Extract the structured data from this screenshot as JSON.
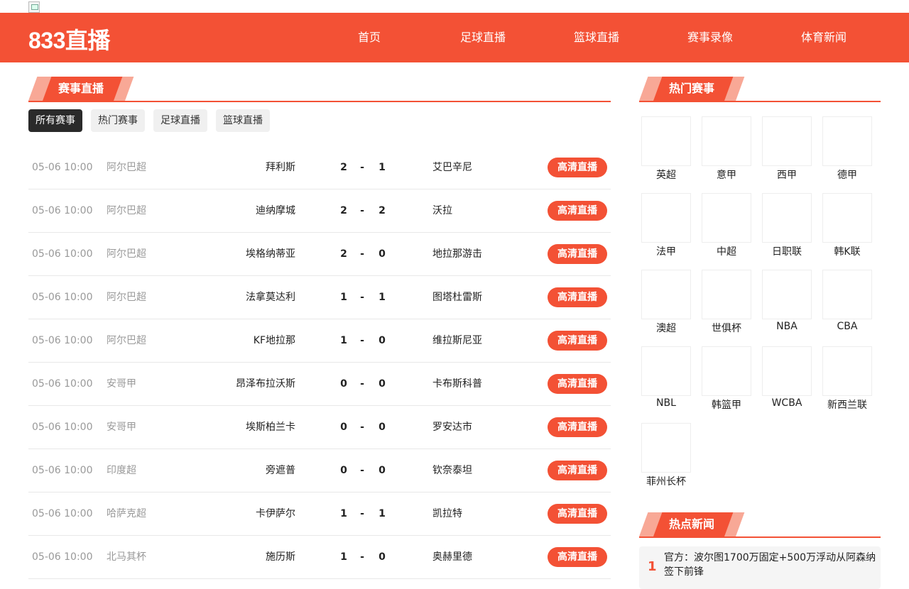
{
  "site": {
    "logo": "833直播"
  },
  "nav": [
    "首页",
    "足球直播",
    "篮球直播",
    "赛事录像",
    "体育新闻"
  ],
  "live_section": {
    "title": "赛事直播",
    "filters": [
      "所有赛事",
      "热门赛事",
      "足球直播",
      "篮球直播"
    ],
    "active_filter": 0,
    "button_label": "高清直播",
    "matches": [
      {
        "time": "05-06 10:00",
        "league": "阿尔巴超",
        "home": "拜利斯",
        "home_score": "2",
        "away_score": "1",
        "away": "艾巴辛尼"
      },
      {
        "time": "05-06 10:00",
        "league": "阿尔巴超",
        "home": "迪纳摩城",
        "home_score": "2",
        "away_score": "2",
        "away": "沃拉"
      },
      {
        "time": "05-06 10:00",
        "league": "阿尔巴超",
        "home": "埃格纳蒂亚",
        "home_score": "2",
        "away_score": "0",
        "away": "地拉那游击"
      },
      {
        "time": "05-06 10:00",
        "league": "阿尔巴超",
        "home": "法拿莫达利",
        "home_score": "1",
        "away_score": "1",
        "away": "图塔杜雷斯"
      },
      {
        "time": "05-06 10:00",
        "league": "阿尔巴超",
        "home": "KF地拉那",
        "home_score": "1",
        "away_score": "0",
        "away": "维拉斯尼亚"
      },
      {
        "time": "05-06 10:00",
        "league": "安哥甲",
        "home": "昂泽布拉沃斯",
        "home_score": "0",
        "away_score": "0",
        "away": "卡布斯科普"
      },
      {
        "time": "05-06 10:00",
        "league": "安哥甲",
        "home": "埃斯柏兰卡",
        "home_score": "0",
        "away_score": "0",
        "away": "罗安达市"
      },
      {
        "time": "05-06 10:00",
        "league": "印度超",
        "home": "旁遮普",
        "home_score": "0",
        "away_score": "0",
        "away": "钦奈泰坦"
      },
      {
        "time": "05-06 10:00",
        "league": "哈萨克超",
        "home": "卡伊萨尔",
        "home_score": "1",
        "away_score": "1",
        "away": "凯拉特"
      },
      {
        "time": "05-06 10:00",
        "league": "北马其杯",
        "home": "施历斯",
        "home_score": "1",
        "away_score": "0",
        "away": "奥赫里德"
      }
    ]
  },
  "hot_section": {
    "title": "热门赛事",
    "leagues": [
      "英超",
      "意甲",
      "西甲",
      "德甲",
      "法甲",
      "中超",
      "日职联",
      "韩K联",
      "澳超",
      "世俱杯",
      "NBA",
      "CBA",
      "NBL",
      "韩篮甲",
      "WCBA",
      "新西兰联",
      "菲州长杯"
    ]
  },
  "news_section": {
    "title": "热点新闻",
    "items": [
      {
        "num": "1",
        "text": "官方：波尔图1700万固定+500万浮动从阿森纳签下前锋"
      }
    ]
  }
}
